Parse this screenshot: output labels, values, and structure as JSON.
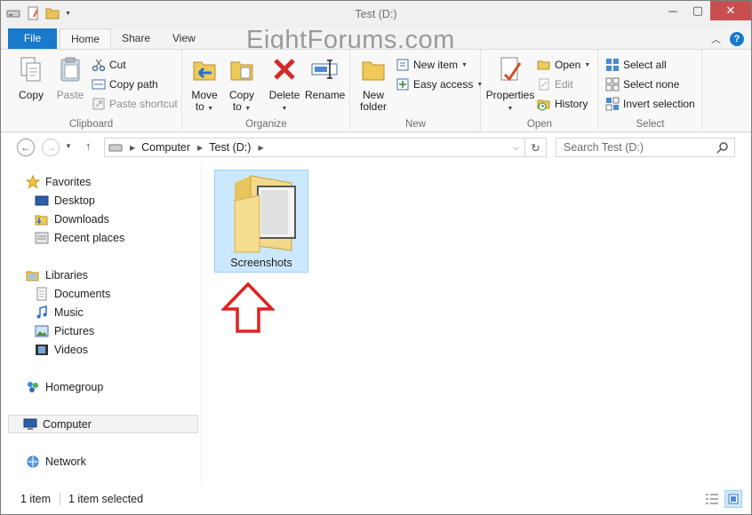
{
  "window": {
    "title": "Test (D:)"
  },
  "watermark": "EightForums.com",
  "tabs": {
    "file": "File",
    "home": "Home",
    "share": "Share",
    "view": "View"
  },
  "ribbon": {
    "clipboard": {
      "label": "Clipboard",
      "copy": "Copy",
      "paste": "Paste",
      "cut": "Cut",
      "copy_path": "Copy path",
      "paste_shortcut": "Paste shortcut"
    },
    "organize": {
      "label": "Organize",
      "move_to_1": "Move",
      "move_to_2": "to",
      "copy_to_1": "Copy",
      "copy_to_2": "to",
      "delete": "Delete",
      "rename": "Rename"
    },
    "new": {
      "label": "New",
      "new_folder_1": "New",
      "new_folder_2": "folder",
      "new_item": "New item",
      "easy_access": "Easy access"
    },
    "open": {
      "label": "Open",
      "properties": "Properties",
      "open": "Open",
      "edit": "Edit",
      "history": "History"
    },
    "select": {
      "label": "Select",
      "select_all": "Select all",
      "select_none": "Select none",
      "invert_selection": "Invert selection"
    }
  },
  "address": {
    "computer": "Computer",
    "drive": "Test (D:)"
  },
  "search": {
    "placeholder": "Search Test (D:)"
  },
  "nav": {
    "favorites": "Favorites",
    "desktop": "Desktop",
    "downloads": "Downloads",
    "recent": "Recent places",
    "libraries": "Libraries",
    "documents": "Documents",
    "music": "Music",
    "pictures": "Pictures",
    "videos": "Videos",
    "homegroup": "Homegroup",
    "computer": "Computer",
    "network": "Network"
  },
  "content": {
    "folder_name": "Screenshots"
  },
  "status": {
    "count": "1 item",
    "selected": "1 item selected"
  },
  "colors": {
    "accent": "#1979ca",
    "close": "#c74f50",
    "selection": "#cce8ff",
    "arrow": "#e02020"
  }
}
